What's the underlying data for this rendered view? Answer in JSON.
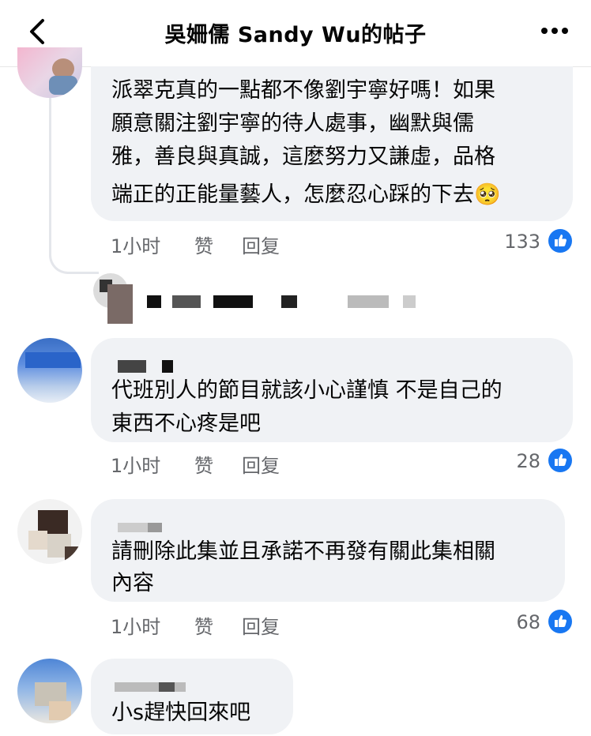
{
  "header": {
    "title": "吳姍儒 Sandy Wu的帖子"
  },
  "comments": [
    {
      "text": "派翠克真的一點都不像劉宇寧好嗎！如果願意關注劉宇寧的待人處事，幽默與儒雅，善良與真誠，這麼努力又謙虛，品格端正的正能量藝人，怎麼忍心踩的下去🥺",
      "line1": "派翠克真的一點都不像劉宇寧好嗎！如果",
      "line2": "願意關注劉宇寧的待人處事，幽默與儒",
      "line3": "雅，善良與真誠，這麼努力又謙虛，品格",
      "line4": "端正的正能量藝人，怎麼忍心踩的下去🥺",
      "time": "1小时",
      "like": "赞",
      "reply": "回复",
      "likes": "133"
    },
    {
      "line1": "代班別人的節目就該小心謹慎 不是自己的",
      "line2": "東西不心疼是吧",
      "time": "1小时",
      "like": "赞",
      "reply": "回复",
      "likes": "28"
    },
    {
      "line1": "請刪除此集並且承諾不再發有關此集相關",
      "line2": "內容",
      "time": "1小时",
      "like": "赞",
      "reply": "回复",
      "likes": "68"
    },
    {
      "line1": "小s趕快回來吧"
    }
  ],
  "colors": {
    "bubble": "#f0f2f5",
    "like_blue": "#1877f2",
    "meta_gray": "#65676b"
  }
}
